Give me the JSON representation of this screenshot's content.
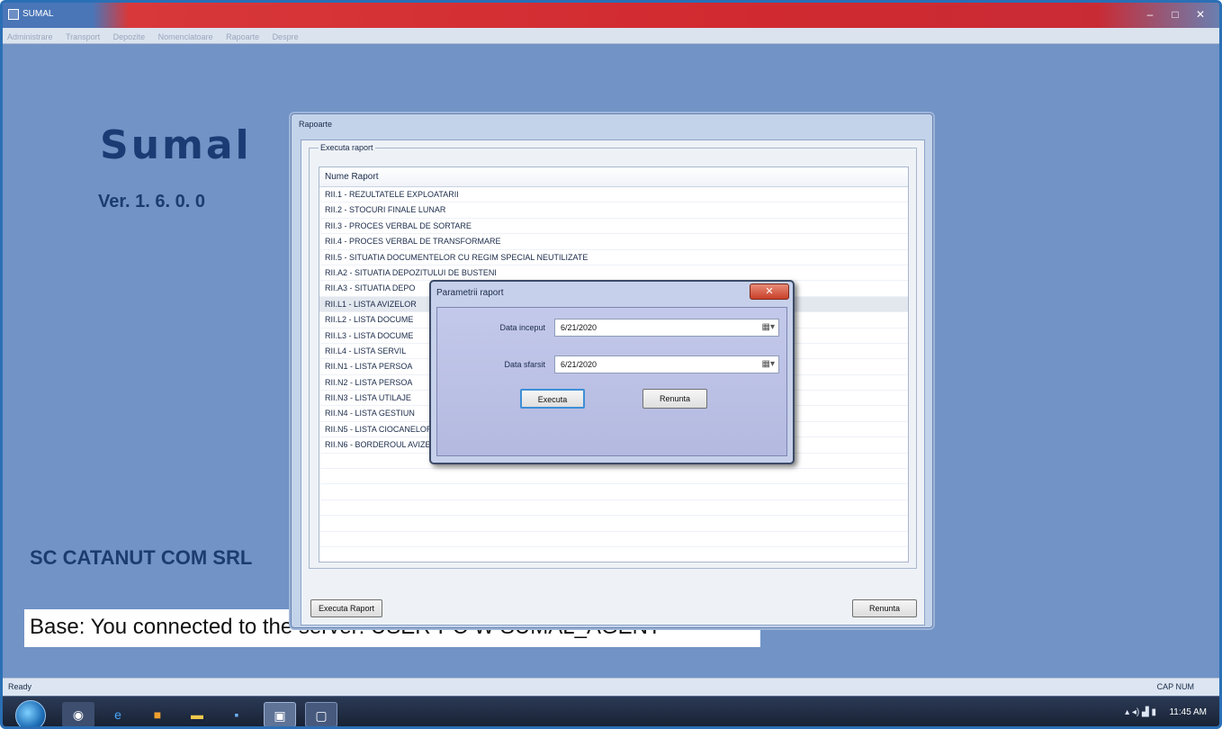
{
  "app": {
    "title": "SUMAL",
    "window_buttons": {
      "minimize": "–",
      "maximize": "□",
      "close": "✕"
    }
  },
  "menu": {
    "items": [
      "Administrare",
      "Transport",
      "Depozite",
      "Nomenclatoare",
      "Rapoarte",
      "Despre"
    ]
  },
  "desktop": {
    "logo_text": "Sumal",
    "version": "Ver. 1. 6. 0. 0",
    "company": "SC CATANUT COM SRL",
    "status_message": "Base: You connected to the server: USER-PC ₩ SUMAL_AGENT"
  },
  "rapoarte_window": {
    "title": "Rapoarte",
    "group_label": "Executa raport",
    "column_header": "Nume Raport",
    "rows": [
      "RII.1 - REZULTATELE EXPLOATARII",
      "RII.2 - STOCURI FINALE LUNAR",
      "RII.3 - PROCES VERBAL DE SORTARE",
      "RII.4 - PROCES VERBAL DE TRANSFORMARE",
      "RII.5 - SITUATIA DOCUMENTELOR CU REGIM SPECIAL NEUTILIZATE",
      "RII.A2 - SITUATIA DEPOZITULUI DE BUSTENI",
      "RII.A3 - SITUATIA DEPO",
      "RII.L1 - LISTA AVIZELOR",
      "RII.L2 - LISTA DOCUME",
      "RII.L3 - LISTA DOCUME",
      "RII.L4 - LISTA SERVIL",
      "RII.N1 - LISTA PERSOA",
      "RII.N2 - LISTA PERSOA",
      "RII.N3 - LISTA UTILAJE",
      "RII.N4 - LISTA GESTIUN",
      "RII.N5 - LISTA CIOCANELOR DE MARCAT",
      "RII.N6 - BORDEROUL AVIZELOR DE INSOTIRE"
    ],
    "execute_button": "Executa Raport",
    "cancel_button": "Renunta"
  },
  "params_dialog": {
    "title": "Parametrii raport",
    "close_label": "✕",
    "start_label": "Data inceput",
    "start_value": "6/21/2020",
    "end_label": "Data sfarsit",
    "end_value": "6/21/2020",
    "execute_button": "Executa",
    "cancel_button": "Renunta"
  },
  "statusbar": {
    "left": "Ready",
    "right": "CAP NUM"
  },
  "taskbar": {
    "clock": "11:45 AM"
  }
}
